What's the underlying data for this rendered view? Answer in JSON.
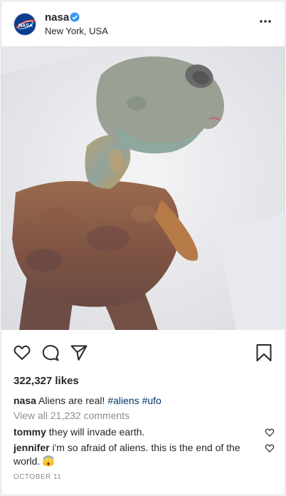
{
  "post": {
    "user": {
      "username": "nasa",
      "location": "New York, USA",
      "avatar_text": "NASA",
      "verified": true
    },
    "photo": {
      "description_icon": "alien-photo"
    },
    "likes": "322,327 likes",
    "caption": {
      "username": "nasa",
      "text": "Aliens are real!",
      "tags": [
        "#aliens",
        "#ufo"
      ]
    },
    "view_all": "View all 21,232 comments",
    "comments": [
      {
        "username": "tommy",
        "text": "they will invade earth."
      },
      {
        "username": "jennifer",
        "text": "i'm so afraid of aliens. this is the end of the world."
      }
    ],
    "date": "OCTOBER 11"
  },
  "colors": {
    "text": "#262626",
    "muted": "#8e8e8e",
    "tag": "#003569",
    "verified": "#3897f0",
    "border": "#dbdbdb"
  }
}
